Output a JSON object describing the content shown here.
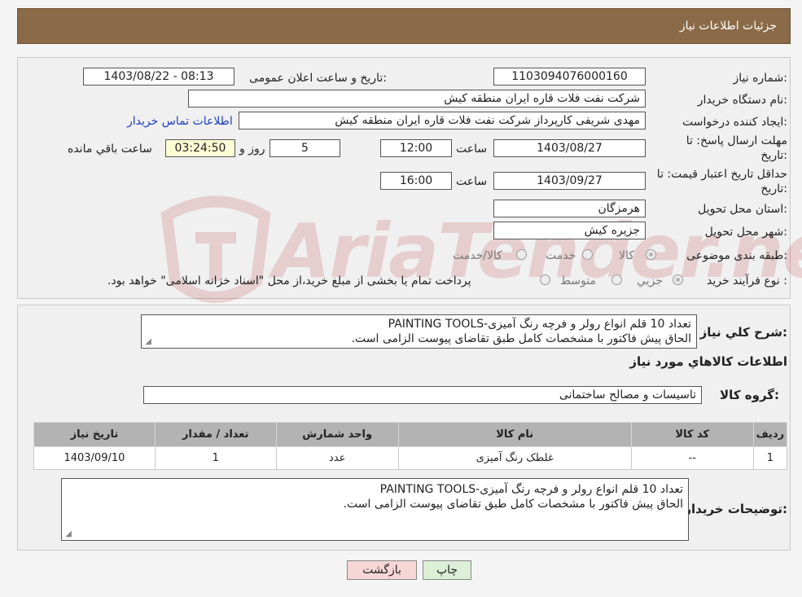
{
  "header": {
    "title": "جزئیات اطلاعات نیاز"
  },
  "form": {
    "need_number": {
      "label": "شماره نیاز:",
      "value": "1103094076000160"
    },
    "announce_date": {
      "label": "تاریخ و ساعت اعلان عمومی:",
      "value": "1403/08/22 - 08:13"
    },
    "buyer_org": {
      "label": "نام دستگاه خریدار:",
      "value": "شرکت نفت فلات قاره ایران منطقه کیش"
    },
    "requester": {
      "label": "ایجاد کننده درخواست:",
      "value": "مهدی شریفی کارپرداز شرکت نفت فلات قاره ایران منطقه کیش",
      "contact_link": "اطلاعات تماس خریدار"
    },
    "reply_deadline": {
      "label_line1": "مهلت ارسال پاسخ: تا",
      "label_line2": "تاریخ:",
      "date": "1403/08/27",
      "time_label": "ساعت",
      "time": "12:00",
      "days": "5",
      "days_label": "روز و",
      "remaining": "03:24:50",
      "remaining_label": "ساعت باقي مانده"
    },
    "price_validity": {
      "label_line1": "حداقل تاریخ اعتبار قیمت: تا",
      "label_line2": "تاریخ:",
      "date": "1403/09/27",
      "time_label": "ساعت",
      "time": "16:00"
    },
    "province": {
      "label": "استان محل تحویل:",
      "value": "هرمزگان"
    },
    "city": {
      "label": "شهر محل تحویل:",
      "value": "جزیره کیش"
    },
    "category": {
      "label": "طبقه بندی موضوعی:",
      "options": [
        "کالا",
        "خدمت",
        "کالا/خدمت"
      ],
      "selected": "کالا"
    },
    "purchase_type": {
      "label": "نوع فرآیند خرید :",
      "options": [
        "جزیي",
        "متوسط"
      ],
      "selected": "جزیي",
      "note": "پرداخت تمام یا بخشی از مبلغ خرید،از محل \"اسناد خزانه اسلامی\" خواهد بود."
    }
  },
  "description": {
    "label": "شرح کلي نياز:",
    "line1": "تعداد 10 قلم انواع رولر و فرچه رنگ آمیزی-PAINTING TOOLS",
    "line2": "الحاق پیش فاکتور با مشخصات کامل طبق تقاضای پیوست الزامی است."
  },
  "goods": {
    "section_title": "اطلاعات كالاهاي مورد نياز",
    "group_label": "گروه کالا:",
    "group_value": "تاسیسات و مصالح ساختمانی",
    "table": {
      "headers": [
        "رديف",
        "کد کالا",
        "نام کالا",
        "واحد شمارش",
        "تعداد / مقدار",
        "تاریخ نیاز"
      ],
      "rows": [
        [
          "1",
          "--",
          "غلطک رنگ آمیزی",
          "عدد",
          "1",
          "1403/09/10"
        ]
      ]
    }
  },
  "buyer_notes": {
    "label": "توضیحات خریدار:",
    "line1": "تعداد 10 قلم انواع رولر و فرچه رنگ آمیزی-PAINTING TOOLS",
    "line2": "الحاق پیش فاکتور با مشخصات کامل طبق تقاضای پیوست الزامی است."
  },
  "actions": {
    "print": "چاپ",
    "back": "بازگشت"
  },
  "watermark": {
    "text": "AriaTender.neT",
    "color": "#b42222"
  }
}
